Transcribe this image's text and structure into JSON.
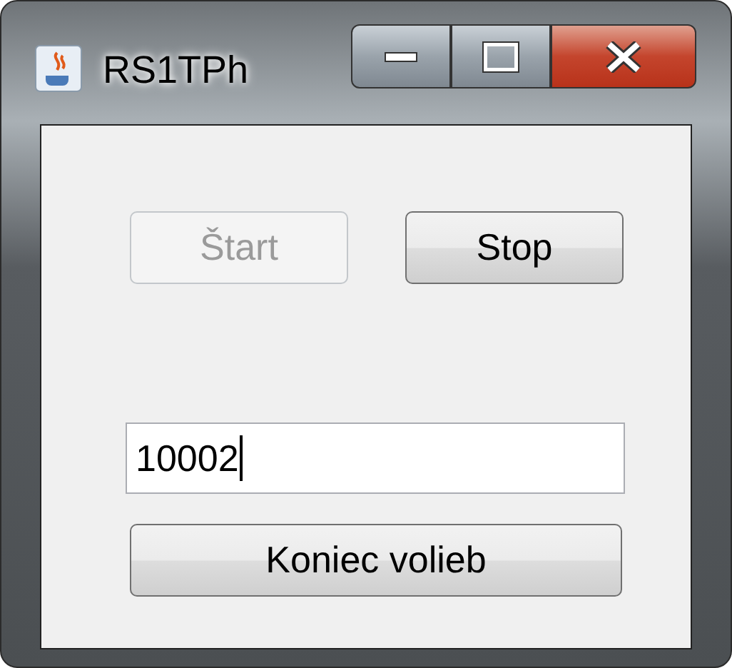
{
  "window": {
    "title": "RS1TPh"
  },
  "buttons": [
    {
      "label": "Štart",
      "disabled": true
    },
    {
      "label": "Stop",
      "disabled": false
    }
  ],
  "field": {
    "value": "10002"
  },
  "end_button": {
    "label": "Koniec volieb",
    "disabled": false
  }
}
